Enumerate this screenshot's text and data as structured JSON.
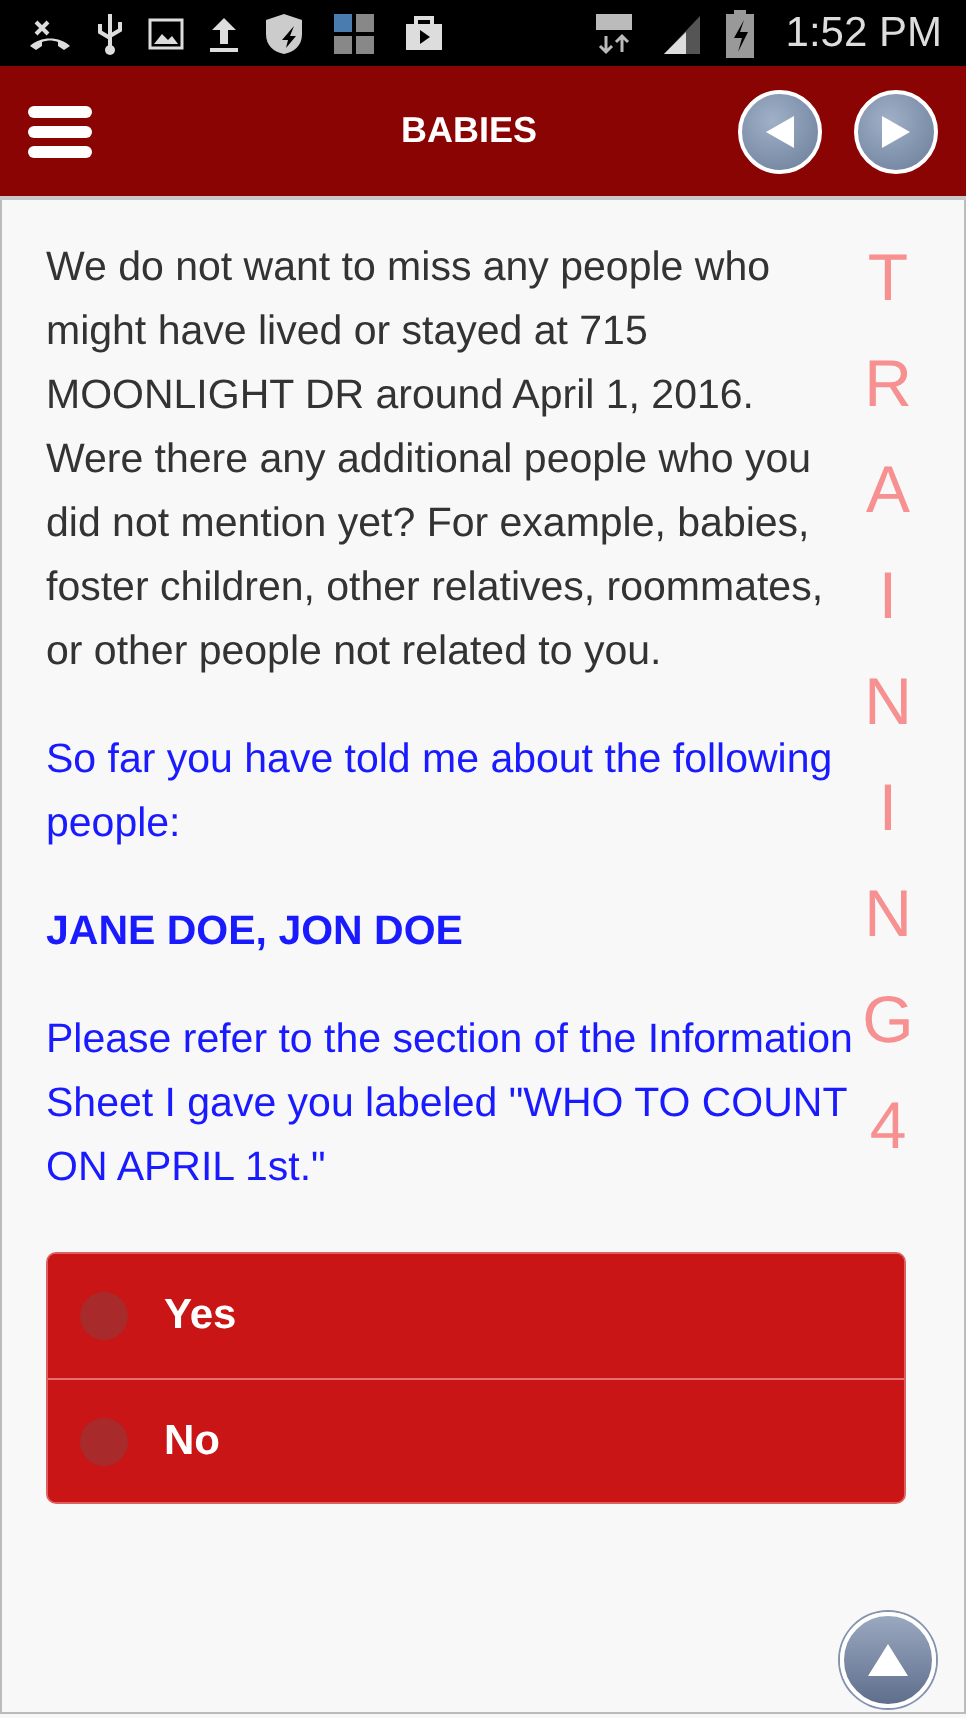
{
  "status_bar": {
    "time": "1:52 PM"
  },
  "header": {
    "title": "BABIES"
  },
  "question": {
    "prompt": "We do not want to miss any people who might have lived or stayed at 715 MOONLIGHT DR around April 1, 2016. Were there any additional people who you did not mention yet? For example, babies, foster children, other relatives, roommates, or other people not related to you.",
    "told_intro": "So far you have told me about the following people:",
    "names": "JANE DOE, JON DOE",
    "refer": "Please refer to the section of the Information Sheet I gave you labeled \"WHO TO COUNT ON APRIL 1st.\""
  },
  "training_mark": "TRAINING4",
  "answers": [
    {
      "label": "Yes",
      "selected": false
    },
    {
      "label": "No",
      "selected": false
    }
  ]
}
